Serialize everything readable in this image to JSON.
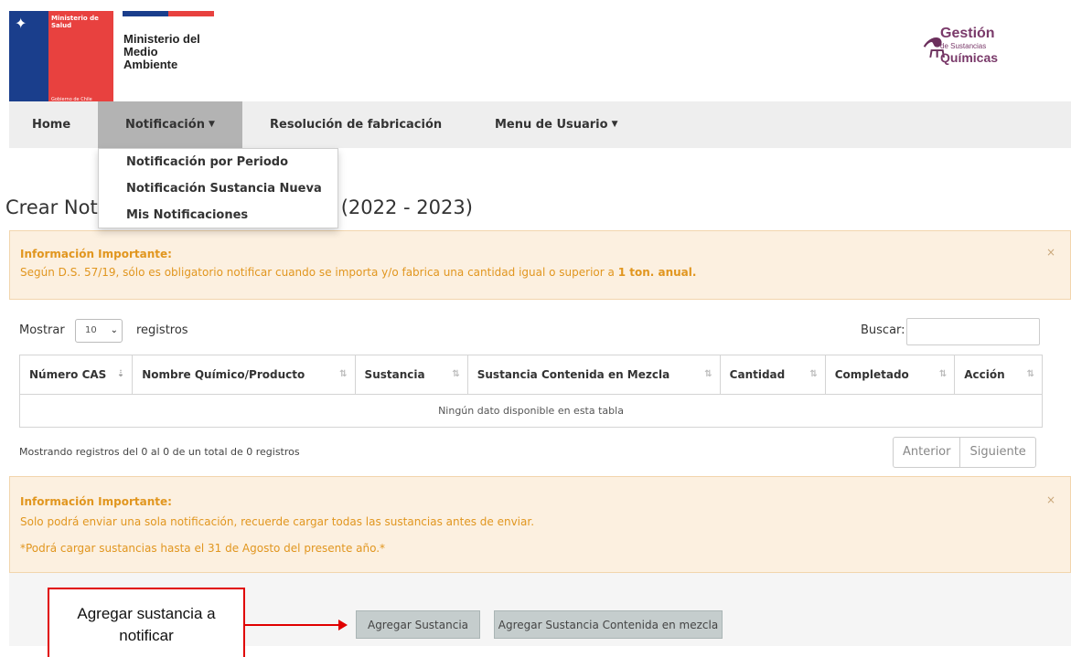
{
  "header": {
    "gob_title_1": "Ministerio de",
    "gob_title_2": "Salud",
    "gob_footer": "Gobierno de Chile",
    "mma_line1": "Ministerio del",
    "mma_line2": "Medio",
    "mma_line3": "Ambiente",
    "gsq_line1": "Gestión",
    "gsq_line2": "de Sustancias",
    "gsq_line3": "Químicas"
  },
  "nav": {
    "home": "Home",
    "notificacion": "Notificación",
    "resolucion": "Resolución de fabricación",
    "menu_usuario": "Menu de Usuario"
  },
  "dropdown": {
    "items": [
      "Notificación por Periodo",
      "Notificación Sustancia Nueva",
      "Mis Notificaciones"
    ]
  },
  "page": {
    "title_start": "Crear Not",
    "title_end": "(2022 - 2023)"
  },
  "alert1": {
    "title": "Información Importante:",
    "text": "Según D.S. 57/19, sólo es obligatorio notificar cuando se importa y/o fabrica una cantidad igual o superior a",
    "bold": "1 ton. anual.",
    "close": "×"
  },
  "controls": {
    "mostrar": "Mostrar",
    "page_size": "10",
    "registros": "registros",
    "buscar": "Buscar:"
  },
  "table": {
    "headers": [
      "Número CAS",
      "Nombre Químico/Producto",
      "Sustancia",
      "Sustancia Contenida en Mezcla",
      "Cantidad",
      "Completado",
      "Acción"
    ],
    "empty": "Ningún dato disponible en esta tabla"
  },
  "footer_info": "Mostrando registros del 0 al 0 de un total de 0 registros",
  "pager": {
    "prev": "Anterior",
    "next": "Siguiente"
  },
  "alert2": {
    "title": "Información Importante:",
    "line1": "Solo podrá enviar una sola notificación, recuerde cargar todas las sustancias antes de enviar.",
    "line2": "*Podrá cargar sustancias hasta el 31 de Agosto del presente año.*",
    "close": "×"
  },
  "callout": {
    "line1": "Agregar sustancia a",
    "line2": "notificar"
  },
  "buttons": {
    "agregar": "Agregar Sustancia",
    "agregar_mezcla": "Agregar Sustancia Contenida en mezcla"
  },
  "colors": {
    "alert_bg": "#fcf0e0",
    "alert_text": "#e1961f",
    "nav_bg": "#eeeeee",
    "nav_active": "#b3b3b3",
    "callout_red": "#e00000"
  }
}
